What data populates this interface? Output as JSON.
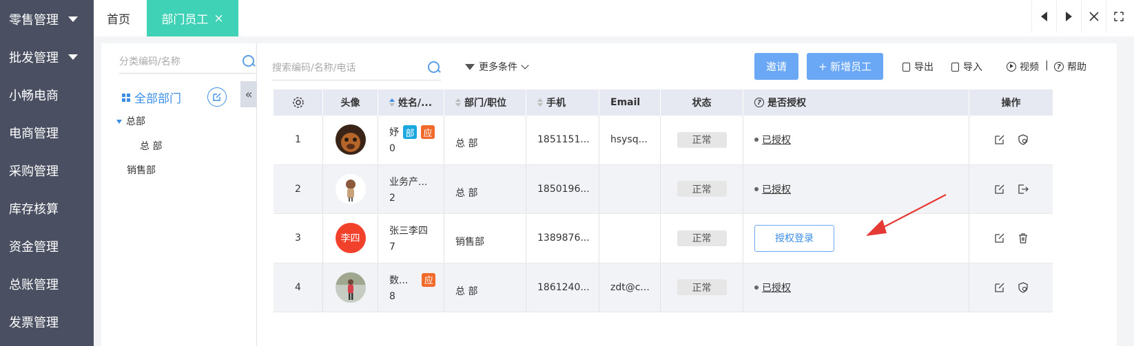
{
  "nav": {
    "items": [
      {
        "label": "零售管理",
        "caret": true
      },
      {
        "label": "批发管理",
        "caret": true
      },
      {
        "label": "小畅电商"
      },
      {
        "label": "电商管理"
      },
      {
        "label": "采购管理"
      },
      {
        "label": "库存核算"
      },
      {
        "label": "资金管理"
      },
      {
        "label": "总账管理"
      },
      {
        "label": "发票管理"
      }
    ]
  },
  "tabs": {
    "home": "首页",
    "active": "部门员工",
    "close": "×"
  },
  "category": {
    "search_placeholder": "分类编码/名称",
    "all_label": "全部部门",
    "collapse": "«",
    "tree": [
      {
        "label": "总部",
        "level": 0,
        "expanded": true
      },
      {
        "label": "总 部",
        "level": 1
      },
      {
        "label": "销售部",
        "level": 0
      }
    ]
  },
  "toolbar": {
    "search_placeholder": "搜索编码/名称/电话",
    "more_filters": "更多条件",
    "invite": "邀请",
    "add_employee": "+ 新增员工",
    "export": "导出",
    "import": "导入",
    "video": "视频",
    "separator": "|",
    "help": "帮助"
  },
  "table": {
    "headers": {
      "settings": "",
      "avatar": "头像",
      "name": "姓名/...",
      "dept": "部门/职位",
      "phone": "手机",
      "email": "Email",
      "status": "状态",
      "auth": "是否授权",
      "ops": "操作"
    },
    "rows": [
      {
        "index": "1",
        "avatar": "photo-dog",
        "name": "妤",
        "code": "0",
        "tags": [
          "部",
          "应"
        ],
        "dept": "总 部",
        "phone": "1851151...",
        "email": "hsysq...",
        "status": "正常",
        "auth": "已授权",
        "authorized": true,
        "ops": [
          "edit-icon",
          "shield-icon"
        ]
      },
      {
        "index": "2",
        "avatar": "photo-doll",
        "name": "业务产...",
        "code": "2",
        "tags": [],
        "dept": "总 部",
        "phone": "1850196...",
        "email": "",
        "status": "正常",
        "auth": "已授权",
        "authorized": true,
        "ops": [
          "edit-icon",
          "logout-icon"
        ]
      },
      {
        "index": "3",
        "avatar_text": "李四",
        "name": "张三李四",
        "code": "7",
        "tags": [],
        "dept": "销售部",
        "phone": "1389876...",
        "email": "",
        "status": "正常",
        "auth": "授权登录",
        "authorized": false,
        "ops": [
          "edit-icon",
          "trash-icon"
        ]
      },
      {
        "index": "4",
        "avatar": "photo-person",
        "name": "数...",
        "code": "8",
        "tags": [
          "应"
        ],
        "dept": "总 部",
        "phone": "1861240...",
        "email": "zdt@c...",
        "status": "正常",
        "auth": "已授权",
        "authorized": true,
        "ops": [
          "edit-icon",
          "shield-icon"
        ]
      }
    ]
  },
  "colors": {
    "nav_bg": "#4a5061",
    "tab_active": "#3fd2b6",
    "primary": "#6aa8f5",
    "tag_blue": "#1aa6df",
    "tag_orange": "#f06a2b",
    "avatar_red": "#f2412b",
    "arrow_red": "#e53935"
  }
}
